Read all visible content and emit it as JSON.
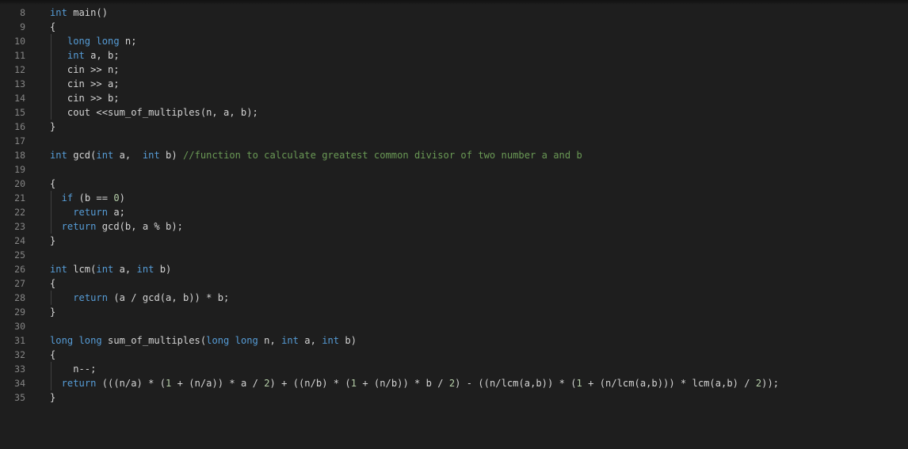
{
  "editor": {
    "language": "cpp",
    "colors": {
      "background": "#1e1e1e",
      "line_number": "#858585",
      "keyword": "#569cd6",
      "text": "#d4d4d4",
      "comment": "#6a9955",
      "number": "#b5cea8"
    },
    "lines": [
      {
        "number": "8",
        "guide": false,
        "tokens": [
          {
            "t": "kw",
            "v": "int"
          },
          {
            "t": "tx",
            "v": " main()"
          }
        ]
      },
      {
        "number": "9",
        "guide": false,
        "tokens": [
          {
            "t": "tx",
            "v": "{"
          }
        ]
      },
      {
        "number": "10",
        "guide": true,
        "tokens": [
          {
            "t": "tx",
            "v": "   "
          },
          {
            "t": "kw",
            "v": "long long"
          },
          {
            "t": "tx",
            "v": " n;"
          }
        ]
      },
      {
        "number": "11",
        "guide": true,
        "tokens": [
          {
            "t": "tx",
            "v": "   "
          },
          {
            "t": "kw",
            "v": "int"
          },
          {
            "t": "tx",
            "v": " a, b;"
          }
        ]
      },
      {
        "number": "12",
        "guide": true,
        "tokens": [
          {
            "t": "tx",
            "v": "   cin >> n;"
          }
        ]
      },
      {
        "number": "13",
        "guide": true,
        "tokens": [
          {
            "t": "tx",
            "v": "   cin >> a;"
          }
        ]
      },
      {
        "number": "14",
        "guide": true,
        "tokens": [
          {
            "t": "tx",
            "v": "   cin >> b;"
          }
        ]
      },
      {
        "number": "15",
        "guide": true,
        "tokens": [
          {
            "t": "tx",
            "v": "   cout <<sum_of_multiples(n, a, b);"
          }
        ]
      },
      {
        "number": "16",
        "guide": false,
        "tokens": [
          {
            "t": "tx",
            "v": "}"
          }
        ]
      },
      {
        "number": "17",
        "guide": false,
        "tokens": []
      },
      {
        "number": "18",
        "guide": false,
        "tokens": [
          {
            "t": "kw",
            "v": "int"
          },
          {
            "t": "tx",
            "v": " gcd("
          },
          {
            "t": "kw",
            "v": "int"
          },
          {
            "t": "tx",
            "v": " a,  "
          },
          {
            "t": "kw",
            "v": "int"
          },
          {
            "t": "tx",
            "v": " b) "
          },
          {
            "t": "cm",
            "v": "//function to calculate greatest common divisor of two number a and b"
          }
        ]
      },
      {
        "number": "19",
        "guide": false,
        "tokens": []
      },
      {
        "number": "20",
        "guide": false,
        "tokens": [
          {
            "t": "tx",
            "v": "{"
          }
        ]
      },
      {
        "number": "21",
        "guide": true,
        "tokens": [
          {
            "t": "tx",
            "v": "  "
          },
          {
            "t": "kw",
            "v": "if"
          },
          {
            "t": "tx",
            "v": " (b == "
          },
          {
            "t": "num",
            "v": "0"
          },
          {
            "t": "tx",
            "v": ")"
          }
        ]
      },
      {
        "number": "22",
        "guide": true,
        "tokens": [
          {
            "t": "tx",
            "v": "    "
          },
          {
            "t": "kw",
            "v": "return"
          },
          {
            "t": "tx",
            "v": " a;"
          }
        ]
      },
      {
        "number": "23",
        "guide": true,
        "tokens": [
          {
            "t": "tx",
            "v": "  "
          },
          {
            "t": "kw",
            "v": "return"
          },
          {
            "t": "tx",
            "v": " gcd(b, a % b);"
          }
        ]
      },
      {
        "number": "24",
        "guide": false,
        "tokens": [
          {
            "t": "tx",
            "v": "}"
          }
        ]
      },
      {
        "number": "25",
        "guide": false,
        "tokens": []
      },
      {
        "number": "26",
        "guide": false,
        "tokens": [
          {
            "t": "kw",
            "v": "int"
          },
          {
            "t": "tx",
            "v": " lcm("
          },
          {
            "t": "kw",
            "v": "int"
          },
          {
            "t": "tx",
            "v": " a, "
          },
          {
            "t": "kw",
            "v": "int"
          },
          {
            "t": "tx",
            "v": " b)"
          }
        ]
      },
      {
        "number": "27",
        "guide": false,
        "tokens": [
          {
            "t": "tx",
            "v": "{"
          }
        ]
      },
      {
        "number": "28",
        "guide": true,
        "tokens": [
          {
            "t": "tx",
            "v": "    "
          },
          {
            "t": "kw",
            "v": "return"
          },
          {
            "t": "tx",
            "v": " (a / gcd(a, b)) * b;"
          }
        ]
      },
      {
        "number": "29",
        "guide": false,
        "tokens": [
          {
            "t": "tx",
            "v": "}"
          }
        ]
      },
      {
        "number": "30",
        "guide": false,
        "tokens": []
      },
      {
        "number": "31",
        "guide": false,
        "tokens": [
          {
            "t": "kw",
            "v": "long long"
          },
          {
            "t": "tx",
            "v": " sum_of_multiples("
          },
          {
            "t": "kw",
            "v": "long long"
          },
          {
            "t": "tx",
            "v": " n, "
          },
          {
            "t": "kw",
            "v": "int"
          },
          {
            "t": "tx",
            "v": " a, "
          },
          {
            "t": "kw",
            "v": "int"
          },
          {
            "t": "tx",
            "v": " b)"
          }
        ]
      },
      {
        "number": "32",
        "guide": false,
        "tokens": [
          {
            "t": "tx",
            "v": "{"
          }
        ]
      },
      {
        "number": "33",
        "guide": true,
        "tokens": [
          {
            "t": "tx",
            "v": "    n--;"
          }
        ]
      },
      {
        "number": "34",
        "guide": true,
        "tokens": [
          {
            "t": "tx",
            "v": "  "
          },
          {
            "t": "kw",
            "v": "return"
          },
          {
            "t": "tx",
            "v": " (((n/a) * ("
          },
          {
            "t": "num",
            "v": "1"
          },
          {
            "t": "tx",
            "v": " + (n/a)) * a / "
          },
          {
            "t": "num",
            "v": "2"
          },
          {
            "t": "tx",
            "v": ") + ((n/b) * ("
          },
          {
            "t": "num",
            "v": "1"
          },
          {
            "t": "tx",
            "v": " + (n/b)) * b / "
          },
          {
            "t": "num",
            "v": "2"
          },
          {
            "t": "tx",
            "v": ") - ((n/lcm(a,b)) * ("
          },
          {
            "t": "num",
            "v": "1"
          },
          {
            "t": "tx",
            "v": " + (n/lcm(a,b))) * lcm(a,b) / "
          },
          {
            "t": "num",
            "v": "2"
          },
          {
            "t": "tx",
            "v": "));"
          }
        ]
      },
      {
        "number": "35",
        "guide": false,
        "tokens": [
          {
            "t": "tx",
            "v": "}"
          }
        ]
      }
    ]
  }
}
